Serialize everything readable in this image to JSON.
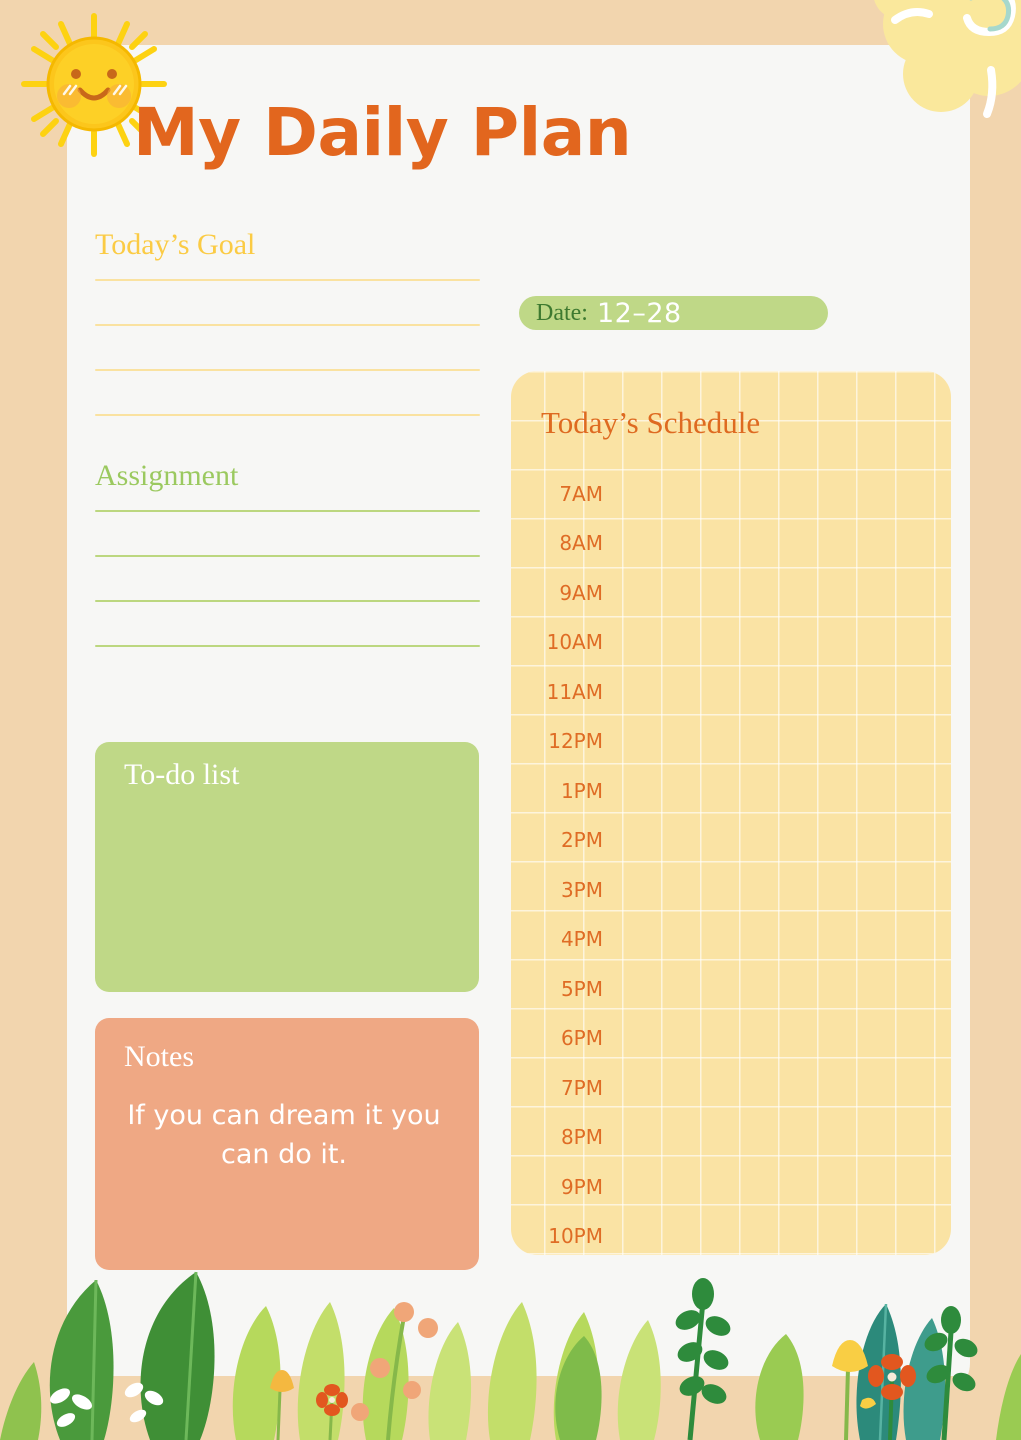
{
  "page": {
    "title": "My Daily Plan",
    "background_color": "#F2D5AE",
    "card_color": "#F7F7F5",
    "title_color": "#E2661E"
  },
  "goal": {
    "heading": "Today’s Goal",
    "heading_color": "#FBCB44",
    "line_color": "#FAE2A0",
    "line_count": 4
  },
  "assignment": {
    "heading": "Assignment",
    "heading_color": "#9BC95F",
    "line_color": "#BCD77F",
    "line_count": 4
  },
  "todo": {
    "heading": "To-do list",
    "card_color": "#BFD887",
    "text_color": "#FFFFFF"
  },
  "notes": {
    "heading": "Notes",
    "quote": "If you can dream it you can do it.",
    "card_color": "#EFA884",
    "text_color": "#FFFFFF"
  },
  "date": {
    "label": "Date:",
    "value": "12–28",
    "badge_color": "#BFD887",
    "label_color": "#3E7A30",
    "value_color": "#FFFFFF"
  },
  "schedule": {
    "heading": "Today’s Schedule",
    "card_color": "#FAE3A4",
    "heading_color": "#DE6A21",
    "slot_color": "#DF6C25",
    "slots": [
      "7AM",
      "8AM",
      "9AM",
      "10AM",
      "11AM",
      "12PM",
      "1PM",
      "2PM",
      "3PM",
      "4PM",
      "5PM",
      "6PM",
      "7PM",
      "8PM",
      "9PM",
      "10PM"
    ]
  },
  "decorations": {
    "sun": "sun-icon",
    "corner_flower": "flower-icon",
    "foliage": "plants-illustration"
  }
}
